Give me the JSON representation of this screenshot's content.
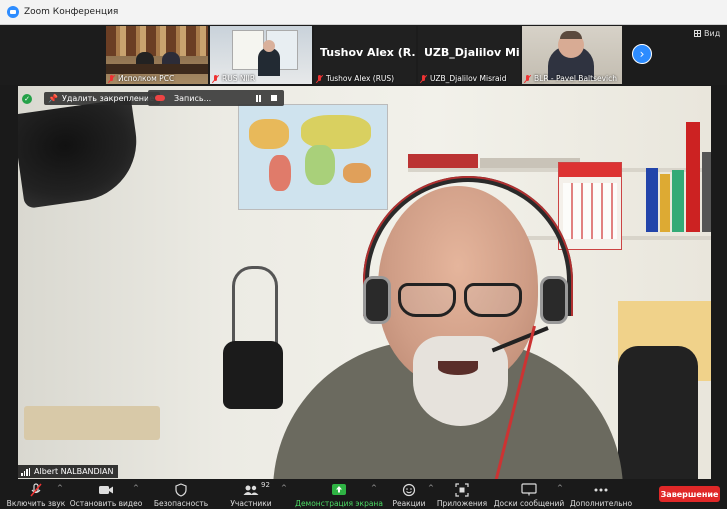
{
  "window": {
    "title": "Zoom Конференция"
  },
  "thumbnails": [
    {
      "label": "Исполком РСС",
      "type": "video"
    },
    {
      "label": "RUS NIIR",
      "type": "video"
    },
    {
      "label": "Tushov Alex (RUS)",
      "display_name": "Tushov Alex (R...",
      "type": "name"
    },
    {
      "label": "UZB_Djalilov Misraid",
      "display_name": "UZB_Djalilov Mi...",
      "type": "name"
    },
    {
      "label": "BLR - Pavel Baltsevich",
      "type": "video"
    }
  ],
  "view_button": {
    "label": "Вид"
  },
  "main_video": {
    "unpin_label": "Удалить закрепление",
    "recording_label": "Запись...",
    "speaker_name": "Albert NALBANDIAN"
  },
  "toolbar": {
    "unmute": "Включить звук",
    "start_video": "Остановить видео",
    "security": "Безопасность",
    "participants": "Участники",
    "participants_count": "92",
    "share_screen": "Демонстрация экрана",
    "reactions": "Реакции",
    "apps": "Приложения",
    "whiteboards": "Доски сообщений",
    "more": "Дополнительно",
    "end": "Завершение"
  },
  "colors": {
    "accent": "#2d8cff",
    "end": "#e02828",
    "share": "#4cd964",
    "muted": "#e33333"
  }
}
